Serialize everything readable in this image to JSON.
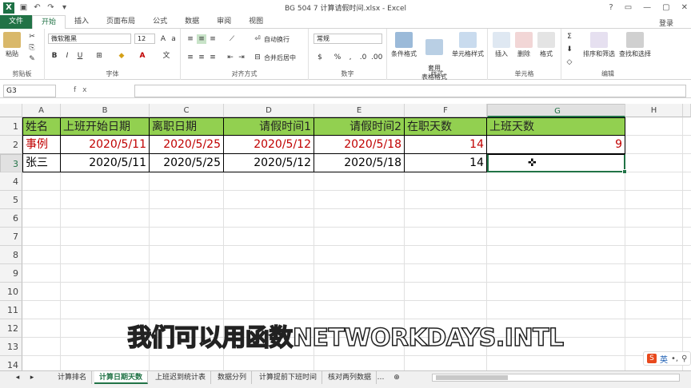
{
  "window": {
    "title": "BG 504 7 计算请假时间.xlsx - Excel",
    "login": "登录"
  },
  "tabs": [
    {
      "label": "文件"
    },
    {
      "label": "开始"
    },
    {
      "label": "插入"
    },
    {
      "label": "页面布局"
    },
    {
      "label": "公式"
    },
    {
      "label": "数据"
    },
    {
      "label": "审阅"
    },
    {
      "label": "视图"
    }
  ],
  "ribbon": {
    "clipboard": {
      "paste": "粘贴",
      "label": "剪贴板"
    },
    "font": {
      "name": "微软雅黑",
      "size": "12",
      "label": "字体"
    },
    "alignment": {
      "wrap": "自动换行",
      "merge": "合并后居中",
      "label": "对齐方式"
    },
    "number": {
      "format": "常规",
      "label": "数字"
    },
    "styles": {
      "conditional": "条件格式",
      "table": "套用\n表格格式",
      "cell": "单元格样式",
      "label": "样式"
    },
    "cells": {
      "insert": "插入",
      "delete": "删除",
      "format": "格式",
      "label": "单元格"
    },
    "editing": {
      "sort": "排序和筛选",
      "find": "查找和选择",
      "label": "编辑"
    }
  },
  "formula_bar": {
    "name_box": "G3",
    "fx": "fx",
    "formula": ""
  },
  "columns": [
    "A",
    "B",
    "C",
    "D",
    "E",
    "F",
    "G",
    "H"
  ],
  "rows": [
    "1",
    "2",
    "3",
    "4",
    "5",
    "6",
    "7",
    "8",
    "9",
    "10",
    "11",
    "12",
    "13",
    "14"
  ],
  "table": {
    "header": [
      "姓名",
      "上班开始日期",
      "离职日期",
      "请假时间1",
      "请假时间2",
      "在职天数",
      "上班天数"
    ],
    "row2": [
      "事例",
      "2020/5/11",
      "2020/5/25",
      "2020/5/12",
      "2020/5/18",
      "14",
      "9"
    ],
    "row3": [
      "张三",
      "2020/5/11",
      "2020/5/25",
      "2020/5/12",
      "2020/5/18",
      "14",
      ""
    ]
  },
  "sheets": [
    "计算排名",
    "计算日期天数",
    "上班迟到统计表",
    "数据分列",
    "计算提前下班时间",
    "核对两列数据"
  ],
  "active_sheet": "计算日期天数",
  "subtitle": "我们可以用函数NETWORKDAYS.INTL",
  "ime": {
    "label": "英"
  },
  "colors": {
    "accent": "#217346",
    "header_fill": "#92d050",
    "example_text": "#c00000"
  }
}
